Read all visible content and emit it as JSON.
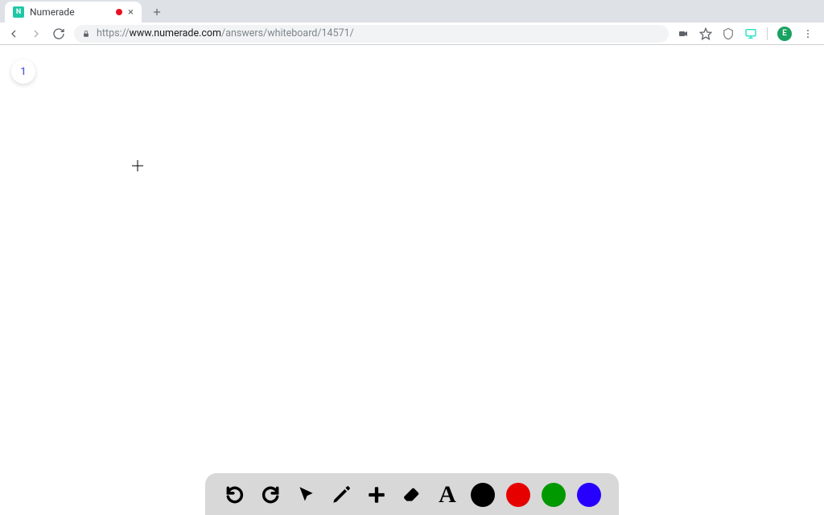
{
  "browser": {
    "tab": {
      "favicon_letter": "N",
      "title": "Numerade",
      "recording": true
    },
    "url": {
      "scheme": "https://",
      "domain": "www.numerade.com",
      "path": "/answers/whiteboard/14571/"
    },
    "profile_initial": "E"
  },
  "page": {
    "slide_number": "1"
  },
  "toolbar": {
    "tools": {
      "undo": "undo",
      "redo": "redo",
      "select": "select",
      "pencil": "pencil",
      "add": "add",
      "erase": "erase",
      "text_label": "A"
    },
    "colors": {
      "black": "#000000",
      "red": "#e60000",
      "green": "#009900",
      "blue": "#2600ff"
    }
  }
}
